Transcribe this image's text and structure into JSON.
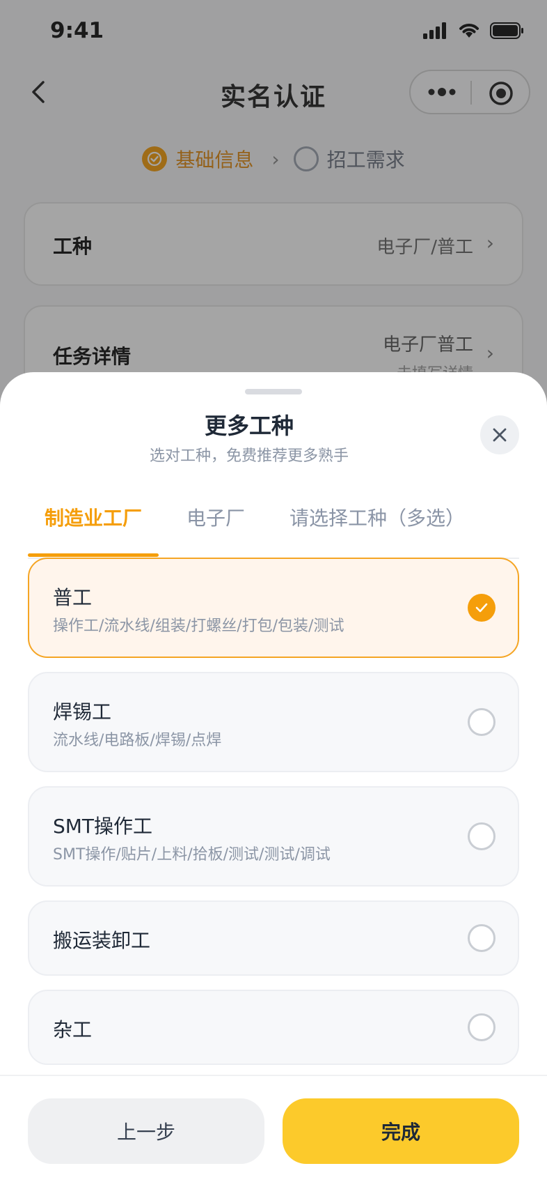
{
  "status_bar": {
    "time": "9:41"
  },
  "nav": {
    "title": "实名认证"
  },
  "steps": {
    "step1": "基础信息",
    "step2": "招工需求"
  },
  "form": {
    "job_type_label": "工种",
    "job_type_value": "电子厂/普工",
    "task_label": "任务详情",
    "task_value": "电子厂普工",
    "task_hint": "未填写详情"
  },
  "sheet": {
    "title": "更多工种",
    "subtitle": "选对工种，免费推荐更多熟手",
    "tabs": [
      "制造业工厂",
      "电子厂",
      "请选择工种（多选）"
    ],
    "options": [
      {
        "name": "普工",
        "desc": "操作工/流水线/组装/打螺丝/打包/包装/测试",
        "selected": true
      },
      {
        "name": "焊锡工",
        "desc": "流水线/电路板/焊锡/点焊",
        "selected": false
      },
      {
        "name": "SMT操作工",
        "desc": "SMT操作/贴片/上料/拾板/测试/测试/调试",
        "selected": false
      },
      {
        "name": "搬运装卸工",
        "desc": "",
        "selected": false
      },
      {
        "name": "杂工",
        "desc": "",
        "selected": false
      }
    ]
  },
  "footer": {
    "prev_label": "上一步",
    "done_label": "完成"
  },
  "colors": {
    "accent": "#f59e0b",
    "primary_button": "#fcca2b"
  }
}
